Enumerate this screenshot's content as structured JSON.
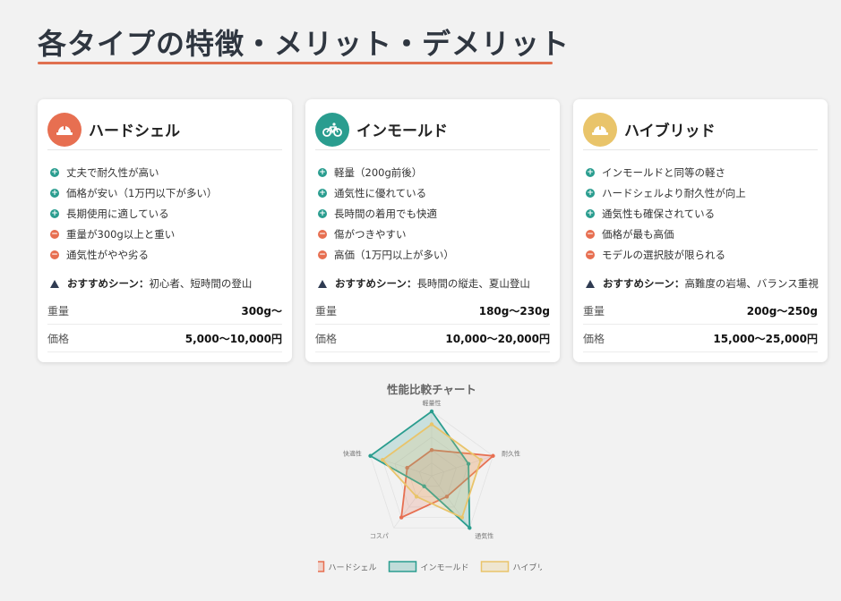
{
  "page": {
    "title": "各タイプの特徴・メリット・デメリット"
  },
  "colors": {
    "hard": "#e76f51",
    "inmold": "#2a9d8f",
    "hybrid": "#e9c46a",
    "accent": "#e07050"
  },
  "cards": [
    {
      "icon": "helmet-icon",
      "title": "ハードシェル",
      "features": [
        {
          "type": "pro",
          "text": "丈夫で耐久性が高い"
        },
        {
          "type": "pro",
          "text": "価格が安い（1万円以下が多い）"
        },
        {
          "type": "pro",
          "text": "長期使用に適している"
        },
        {
          "type": "con",
          "text": "重量が300g以上と重い"
        },
        {
          "type": "con",
          "text": "通気性がやや劣る"
        }
      ],
      "rec_label": "おすすめシーン：",
      "rec_text": "初心者、短時間の登山",
      "specs": [
        {
          "k": "重量",
          "v": "300g〜"
        },
        {
          "k": "価格",
          "v": "5,000〜10,000円"
        }
      ]
    },
    {
      "icon": "bicycle-icon",
      "title": "インモールド",
      "features": [
        {
          "type": "pro",
          "text": "軽量（200g前後）"
        },
        {
          "type": "pro",
          "text": "通気性に優れている"
        },
        {
          "type": "pro",
          "text": "長時間の着用でも快適"
        },
        {
          "type": "con",
          "text": "傷がつきやすい"
        },
        {
          "type": "con",
          "text": "高価（1万円以上が多い）"
        }
      ],
      "rec_label": "おすすめシーン：",
      "rec_text": "長時間の縦走、夏山登山",
      "specs": [
        {
          "k": "重量",
          "v": "180g〜230g"
        },
        {
          "k": "価格",
          "v": "10,000〜20,000円"
        }
      ]
    },
    {
      "icon": "helmet-icon",
      "title": "ハイブリッド",
      "features": [
        {
          "type": "pro",
          "text": "インモールドと同等の軽さ"
        },
        {
          "type": "pro",
          "text": "ハードシェルより耐久性が向上"
        },
        {
          "type": "pro",
          "text": "通気性も確保されている"
        },
        {
          "type": "con",
          "text": "価格が最も高価"
        },
        {
          "type": "con",
          "text": "モデルの選択肢が限られる"
        }
      ],
      "rec_label": "おすすめシーン：",
      "rec_text": "高難度の岩場、バランス重視",
      "specs": [
        {
          "k": "重量",
          "v": "200g〜250g"
        },
        {
          "k": "価格",
          "v": "15,000〜25,000円"
        }
      ]
    }
  ],
  "chart_data": {
    "type": "radar",
    "title": "性能比較チャート",
    "axes": [
      "軽量性",
      "耐久性",
      "通気性",
      "コスパ",
      "快適性"
    ],
    "range": [
      0,
      5
    ],
    "legend_position": "bottom",
    "series": [
      {
        "name": "ハードシェル",
        "color": "#e76f51",
        "values": [
          2,
          5,
          2,
          4,
          2
        ]
      },
      {
        "name": "インモールド",
        "color": "#2a9d8f",
        "values": [
          5,
          3,
          5,
          1,
          5
        ]
      },
      {
        "name": "ハイブリッド",
        "color": "#e9c46a",
        "values": [
          4,
          4,
          4,
          2,
          4
        ]
      }
    ]
  }
}
